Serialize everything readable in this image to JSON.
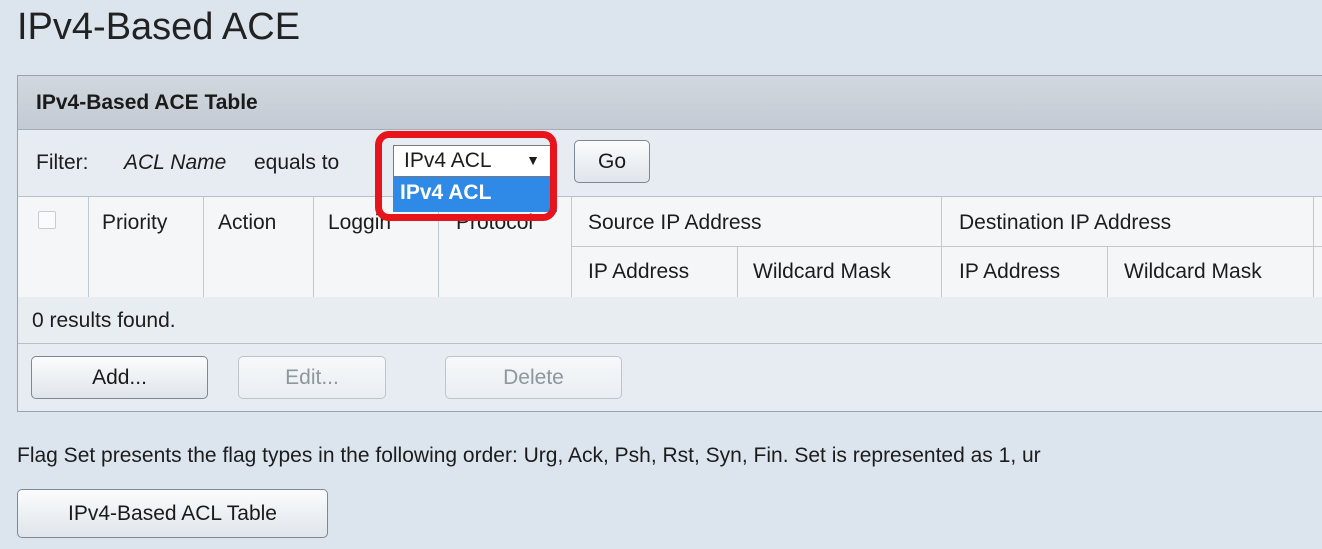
{
  "page": {
    "title": "IPv4-Based ACE"
  },
  "panel": {
    "title": "IPv4-Based ACE Table",
    "filter": {
      "label": "Filter:",
      "field": "ACL Name",
      "operator": "equals to",
      "select_value": "IPv4 ACL",
      "dropdown_options": [
        "IPv4 ACL"
      ],
      "go_label": "Go"
    },
    "table": {
      "columns": {
        "priority": "Priority",
        "action": "Action",
        "logging": "Loggin",
        "protocol": "Protocol",
        "source_group": "Source IP Address",
        "destination_group": "Destination IP Address",
        "src_ip": "IP Address",
        "src_mask": "Wildcard Mask",
        "dst_ip": "IP Address",
        "dst_mask": "Wildcard Mask"
      },
      "rows": []
    },
    "results_text": "0 results found.",
    "buttons": {
      "add": "Add...",
      "edit": "Edit...",
      "delete": "Delete"
    }
  },
  "note": "Flag Set presents the flag types in the following order: Urg, Ack, Psh, Rst, Syn, Fin. Set is represented as 1, ur",
  "acl_table_button": "IPv4-Based ACL Table",
  "colors": {
    "highlight": "#e8141c",
    "dropdown_selected": "#2e8ae6",
    "background": "#dce5ee"
  }
}
